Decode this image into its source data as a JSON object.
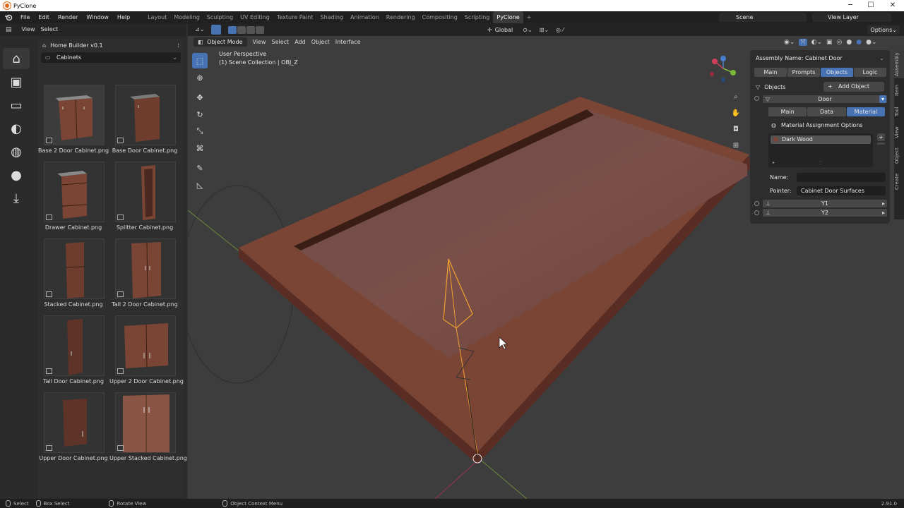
{
  "window": {
    "title": "PyClone",
    "controls": [
      "─",
      "☐",
      "✕"
    ]
  },
  "menubar": {
    "menus": [
      "File",
      "Edit",
      "Render",
      "Window",
      "Help"
    ],
    "workspaces": [
      "Layout",
      "Modeling",
      "Sculpting",
      "UV Editing",
      "Texture Paint",
      "Shading",
      "Animation",
      "Rendering",
      "Compositing",
      "Scripting",
      "PyClone"
    ],
    "active_workspace": "PyClone",
    "add_tab": "+",
    "scene": "Scene",
    "view_layer": "View Layer"
  },
  "asset_browser": {
    "header_menus": [
      "View",
      "Select"
    ],
    "panel_title": "Home Builder v0.1",
    "category": "Cabinets",
    "items": [
      {
        "label": "Base 2 Door Cabinet.png"
      },
      {
        "label": "Base Door Cabinet.png"
      },
      {
        "label": "Drawer Cabinet.png"
      },
      {
        "label": "Splitter Cabinet.png"
      },
      {
        "label": "Stacked Cabinet.png"
      },
      {
        "label": "Tall 2 Door Cabinet.png"
      },
      {
        "label": "Tall Door Cabinet.png"
      },
      {
        "label": "Upper 2 Door Cabinet.png"
      },
      {
        "label": "Upper Door Cabinet.png"
      },
      {
        "label": "Upper Stacked Cabinet.png"
      }
    ]
  },
  "viewport": {
    "mode": "Object Mode",
    "menus": [
      "View",
      "Select",
      "Add",
      "Object",
      "Interface"
    ],
    "orientation": "Global",
    "options_label": "Options",
    "info_line1": "User Perspective",
    "info_line2": "(1) Scene Collection | OBJ_Z",
    "gizmo_labels": {
      "x": "X",
      "y": "Y",
      "z": "Z"
    }
  },
  "npanel": {
    "assembly_name": "Assembly Name: Cabinet Door",
    "tabs": [
      "Main",
      "Prompts",
      "Objects",
      "Logic"
    ],
    "active_tab": "Objects",
    "objects_label": "Objects",
    "add_object": "Add Object",
    "selected_object": "Door",
    "subtabs": [
      "Main",
      "Data",
      "Material"
    ],
    "active_subtab": "Material",
    "material_options": "Material Assignment Options",
    "material_slot": "Dark Wood",
    "name_label": "Name:",
    "name_value": "",
    "pointer_label": "Pointer:",
    "pointer_value": "Cabinet Door Surfaces",
    "empties": [
      "Y1",
      "Y2"
    ]
  },
  "side_tabs": [
    "Assembly",
    "Item",
    "Tool",
    "View",
    "Object",
    "Create"
  ],
  "statusbar": {
    "items": [
      "Select",
      "Box Select",
      "Rotate View",
      "Object Context Menu"
    ],
    "version": "2.91.0"
  },
  "colors": {
    "accent": "#4772b3",
    "wood": "#7a4535",
    "wood_dark": "#5e3328",
    "selection": "#f0a030"
  }
}
